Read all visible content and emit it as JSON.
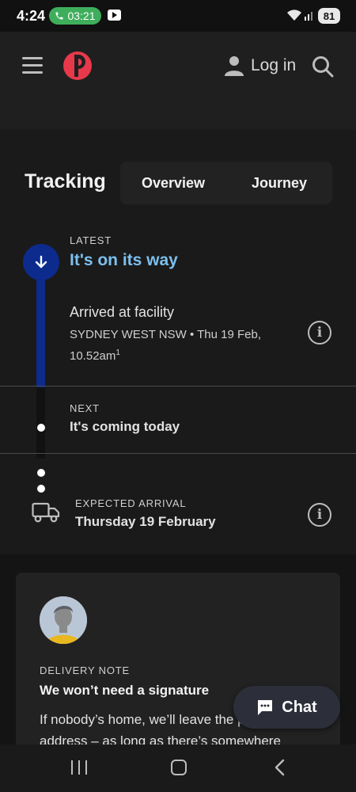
{
  "status_bar": {
    "time": "4:24",
    "call_timer": "03:21",
    "battery": "81"
  },
  "header": {
    "login_label": "Log in",
    "brand_color": "#e8394b"
  },
  "tracking": {
    "title": "Tracking",
    "tabs": [
      {
        "label": "Overview"
      },
      {
        "label": "Journey"
      }
    ]
  },
  "timeline": {
    "latest": {
      "label": "LATEST",
      "status": "It's on its way",
      "event_title": "Arrived at facility",
      "event_detail": "SYDNEY WEST NSW • Thu 19 Feb, 10.52am",
      "footnote": "1"
    },
    "next": {
      "label": "NEXT",
      "status": "It's coming today"
    },
    "expected": {
      "label": "EXPECTED ARRIVAL",
      "value": "Thursday 19 February"
    },
    "colors": {
      "progress": "#0d2b8c",
      "status_text": "#7cc0ee"
    }
  },
  "delivery_note": {
    "label": "DELIVERY NOTE",
    "title": "We won’t need a signature",
    "body": "If nobody’s home, we’ll leave the parcel at the address – as long as there’s somewhere"
  },
  "chat": {
    "label": "Chat"
  }
}
